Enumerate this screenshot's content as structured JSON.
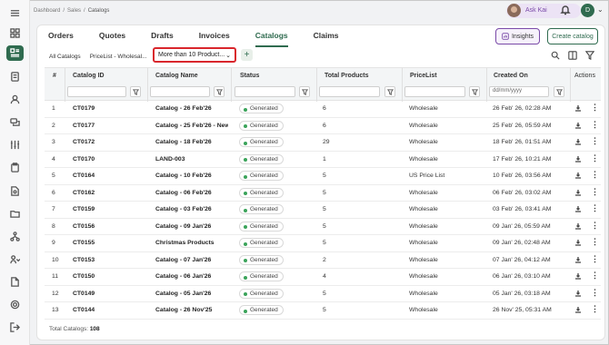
{
  "breadcrumb": [
    "Dashboard",
    "Sales",
    "Catalogs"
  ],
  "breadcrumb_sep": "/",
  "header": {
    "ask_kai": "Ask Kai",
    "user_initial": "D"
  },
  "tabs": [
    "Orders",
    "Quotes",
    "Drafts",
    "Invoices",
    "Catalogs",
    "Claims"
  ],
  "active_tab": "Catalogs",
  "buttons": {
    "insights": "Insights",
    "create": "Create catalog"
  },
  "filters": [
    "All Catalogs",
    "PriceList - Wholesal..."
  ],
  "selected_filter": "More than 10 Product...",
  "columns": {
    "num": "#",
    "id": "Catalog ID",
    "name": "Catalog Name",
    "status": "Status",
    "total": "Total Products",
    "pricelist": "PriceList",
    "created": "Created On",
    "actions": "Actions"
  },
  "date_placeholder": "dd/mm/yyyy",
  "rows": [
    {
      "n": "1",
      "id": "CT0179",
      "name": "Catalog - 26 Feb'26",
      "status": "Generated",
      "total": "6",
      "pricelist": "Wholesale",
      "created": "26 Feb' 26, 02:28 AM"
    },
    {
      "n": "2",
      "id": "CT0177",
      "name": "Catalog - 25 Feb'26 - New I",
      "status": "Generated",
      "total": "6",
      "pricelist": "Wholesale",
      "created": "25 Feb' 26, 05:59 AM"
    },
    {
      "n": "3",
      "id": "CT0172",
      "name": "Catalog - 18 Feb'26",
      "status": "Generated",
      "total": "29",
      "pricelist": "Wholesale",
      "created": "18 Feb' 26, 01:51 AM"
    },
    {
      "n": "4",
      "id": "CT0170",
      "name": "LAND-003",
      "status": "Generated",
      "total": "1",
      "pricelist": "Wholesale",
      "created": "17 Feb' 26, 10:21 AM"
    },
    {
      "n": "5",
      "id": "CT0164",
      "name": "Catalog - 10 Feb'26",
      "status": "Generated",
      "total": "5",
      "pricelist": "US Price List",
      "created": "10 Feb' 26, 03:56 AM"
    },
    {
      "n": "6",
      "id": "CT0162",
      "name": "Catalog - 06 Feb'26",
      "status": "Generated",
      "total": "5",
      "pricelist": "Wholesale",
      "created": "06 Feb' 26, 03:02 AM"
    },
    {
      "n": "7",
      "id": "CT0159",
      "name": "Catalog - 03 Feb'26",
      "status": "Generated",
      "total": "5",
      "pricelist": "Wholesale",
      "created": "03 Feb' 26, 03:41 AM"
    },
    {
      "n": "8",
      "id": "CT0156",
      "name": "Catalog - 09 Jan'26",
      "status": "Generated",
      "total": "5",
      "pricelist": "Wholesale",
      "created": "09 Jan' 26, 05:59 AM"
    },
    {
      "n": "9",
      "id": "CT0155",
      "name": "Christmas Products",
      "status": "Generated",
      "total": "5",
      "pricelist": "Wholesale",
      "created": "09 Jan' 26, 02:48 AM"
    },
    {
      "n": "10",
      "id": "CT0153",
      "name": "Catalog - 07 Jan'26",
      "status": "Generated",
      "total": "2",
      "pricelist": "Wholesale",
      "created": "07 Jan' 26, 04:12 AM"
    },
    {
      "n": "11",
      "id": "CT0150",
      "name": "Catalog - 06 Jan'26",
      "status": "Generated",
      "total": "4",
      "pricelist": "Wholesale",
      "created": "06 Jan' 26, 03:10 AM"
    },
    {
      "n": "12",
      "id": "CT0149",
      "name": "Catalog - 05 Jan'26",
      "status": "Generated",
      "total": "5",
      "pricelist": "Wholesale",
      "created": "05 Jan' 26, 03:18 AM"
    },
    {
      "n": "13",
      "id": "CT0144",
      "name": "Catalog - 26 Nov'25",
      "status": "Generated",
      "total": "5",
      "pricelist": "Wholesale",
      "created": "26 Nov' 25, 05:31 AM"
    }
  ],
  "footer": {
    "label": "Total Catalogs:",
    "count": "108"
  },
  "colors": {
    "accent": "#2f6b4f",
    "highlight": "#d9262c",
    "kai": "#7a4aa8"
  }
}
